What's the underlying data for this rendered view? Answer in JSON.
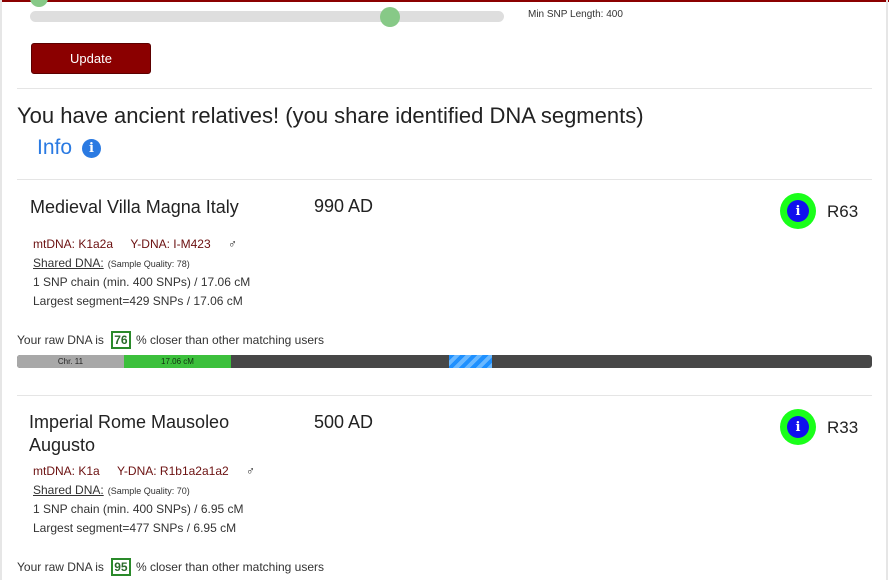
{
  "slider": {
    "label": "Min SNP Length: 400",
    "value_fraction": 0.76
  },
  "update_label": "Update",
  "heading": "You have ancient relatives! (you share identified DNA segments)",
  "info_label": "Info",
  "info_glyph": "i",
  "cards": [
    {
      "title_lines": [
        "Medieval Villa Magna Italy"
      ],
      "date": "990 AD",
      "badge_code": "R63",
      "mtdna": "mtDNA: K1a2a",
      "ydna": "Y-DNA: I-M423",
      "sex_symbol": "♂",
      "shared_label": "Shared DNA:",
      "sample_quality": "(Sample Quality: 78)",
      "chain": "1 SNP chain (min. 400 SNPs) / 17.06 cM",
      "largest": "Largest segment=429 SNPs / 17.06 cM",
      "raw_prefix": "Your raw DNA is",
      "percent": "76",
      "raw_suffix": "% closer than other matching users",
      "chromosome": {
        "label": "Chr. 11",
        "segment_label": "17.06 cM"
      }
    },
    {
      "title_lines": [
        "Imperial Rome Mausoleo",
        "Augusto"
      ],
      "date": "500 AD",
      "badge_code": "R33",
      "mtdna": "mtDNA: K1a",
      "ydna": "Y-DNA: R1b1a2a1a2",
      "sex_symbol": "♂",
      "shared_label": "Shared DNA:",
      "sample_quality": "(Sample Quality: 70)",
      "chain": "1 SNP chain (min. 400 SNPs) / 6.95 cM",
      "largest": "Largest segment=477 SNPs / 6.95 cM",
      "raw_prefix": "Your raw DNA is",
      "percent": "95",
      "raw_suffix": "% closer than other matching users"
    }
  ],
  "colors": {
    "accent": "#8b0000",
    "link": "#2a7ae2",
    "badge_ring": "#1aff1a",
    "badge_inner": "#1010ee"
  }
}
